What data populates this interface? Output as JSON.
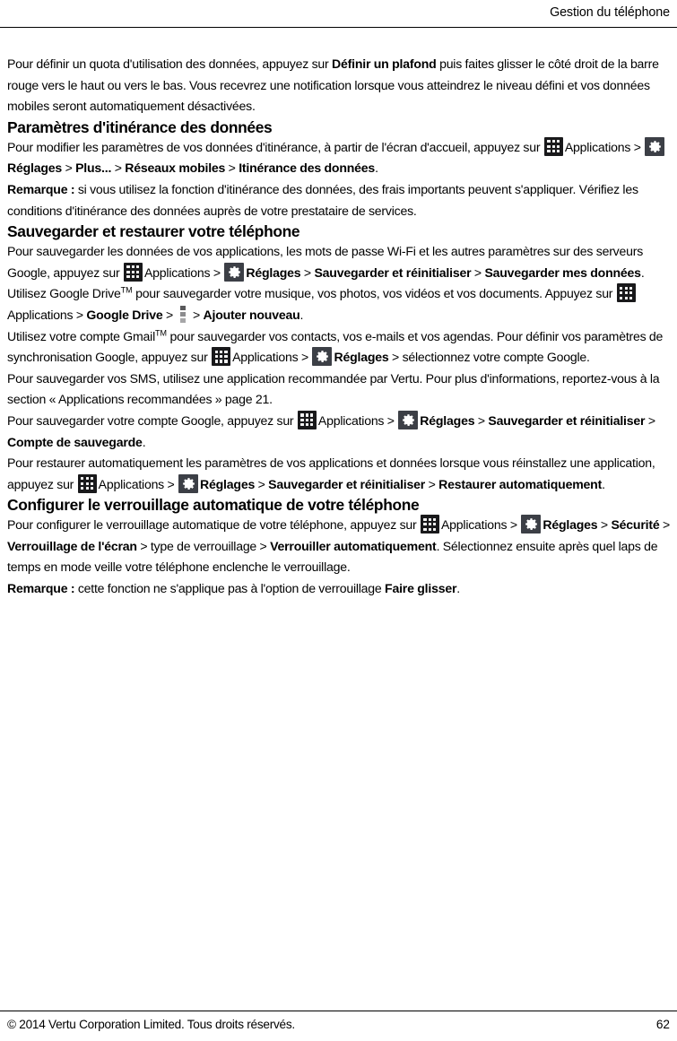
{
  "document": {
    "header_title": "Gestion du téléphone",
    "footer_copyright": "© 2014 Vertu Corporation Limited. Tous droits réservés.",
    "page_number": "62"
  },
  "icons": {
    "apps": "apps-grid-icon",
    "settings": "settings-gear-icon",
    "overflow": "overflow-menu-icon"
  },
  "intro": {
    "p1_a": "Pour définir un quota d'utilisation des données, appuyez sur ",
    "p1_b": "Définir un plafond",
    "p1_c": " puis faites glisser le côté droit de la barre rouge vers le haut ou vers le bas. Vous recevrez une notification lorsque vous atteindrez le niveau défini et vos données mobiles seront automatiquement désactivées."
  },
  "section_roaming": {
    "heading": "Paramètres d'itinérance des données",
    "p1_a": "Pour modifier les paramètres de vos données d'itinérance, à partir de l'écran d'accueil, appuyez sur ",
    "p1_apps_label": "Applications",
    "p1_sep1": " > ",
    "p1_settings_label": "Réglages",
    "p1_sep2": " > ",
    "p1_b": "Plus...",
    "p1_sep3": " > ",
    "p1_c": "Réseaux mobiles",
    "p1_sep4": " > ",
    "p1_d": "Itinérance des données",
    "p1_end": ".",
    "note_label": "Remarque :",
    "note_text": " si vous utilisez la fonction d'itinérance des données, des frais importants peuvent s'appliquer. Vérifiez les conditions d'itinérance des données auprès de votre prestataire de services."
  },
  "section_backup": {
    "heading": "Sauvegarder et restaurer votre téléphone",
    "p1_a": "Pour sauvegarder les données de vos applications, les mots de passe Wi-Fi et les autres paramètres sur des serveurs Google, appuyez sur ",
    "p1_apps_label": "Applications",
    "p1_sep1": " > ",
    "p1_settings_label": "Réglages",
    "p1_sep2": " > ",
    "p1_b": "Sauvegarder et réinitialiser",
    "p1_sep3": " > ",
    "p1_c": "Sauvegarder mes données",
    "p1_end": ".",
    "p2_a": "Utilisez Google Drive",
    "p2_tm": "TM",
    "p2_b": " pour sauvegarder votre musique, vos photos, vos vidéos et vos documents. Appuyez sur ",
    "p2_apps_label": "Applications",
    "p2_sep1": " > ",
    "p2_c": "Google Drive",
    "p2_sep2": " > ",
    "p2_sep3": " > ",
    "p2_d": "Ajouter nouveau",
    "p2_end": ".",
    "p3_a": "Utilisez votre compte Gmail",
    "p3_tm": "TM",
    "p3_b": " pour sauvegarder vos contacts, vos e-mails et vos agendas. Pour définir vos paramètres de synchronisation Google, appuyez sur ",
    "p3_apps_label": "Applications",
    "p3_sep1": " > ",
    "p3_settings_label": "Réglages",
    "p3_sep2": " > ",
    "p3_c": "sélectionnez votre compte Google.",
    "p4": "Pour sauvegarder vos SMS, utilisez une application recommandée par Vertu. Pour plus d'informations, reportez-vous à la section « Applications recommandées » page 21.",
    "p5_a": "Pour sauvegarder votre compte Google, appuyez sur ",
    "p5_apps_label": "Applications",
    "p5_sep1": " > ",
    "p5_settings_label": "Réglages",
    "p5_sep2": " > ",
    "p5_b": "Sauvegarder et réinitialiser",
    "p5_sep3": " > ",
    "p5_c": "Compte de sauvegarde",
    "p5_end": ".",
    "p6_a": "Pour restaurer automatiquement les paramètres de vos applications et données lorsque vous réinstallez une application, appuyez sur ",
    "p6_apps_label": "Applications",
    "p6_sep1": " > ",
    "p6_settings_label": "Réglages",
    "p6_sep2": " > ",
    "p6_b": "Sauvegarder et réinitialiser",
    "p6_sep3": " > ",
    "p6_c": "Restaurer automatiquement",
    "p6_end": "."
  },
  "section_autolock": {
    "heading": "Configurer le verrouillage automatique de votre téléphone",
    "p1_a": "Pour configurer le verrouillage automatique de votre téléphone, appuyez sur ",
    "p1_apps_label": "Applications",
    "p1_sep1": " > ",
    "p1_settings_label": "Réglages",
    "p1_sep2": " > ",
    "p1_b": "Sécurité",
    "p1_sep3": " > ",
    "p1_c": "Verrouillage de l'écran",
    "p1_sep4": " > type de verrouillage > ",
    "p1_d": "Verrouiller automatiquement",
    "p1_e": ". Sélectionnez ensuite après quel laps de temps en mode veille votre téléphone enclenche le verrouillage.",
    "note_label": "Remarque :",
    "note_text_a": " cette fonction ne s'applique pas à l'option de verrouillage ",
    "note_text_b": "Faire glisser",
    "note_end": "."
  }
}
